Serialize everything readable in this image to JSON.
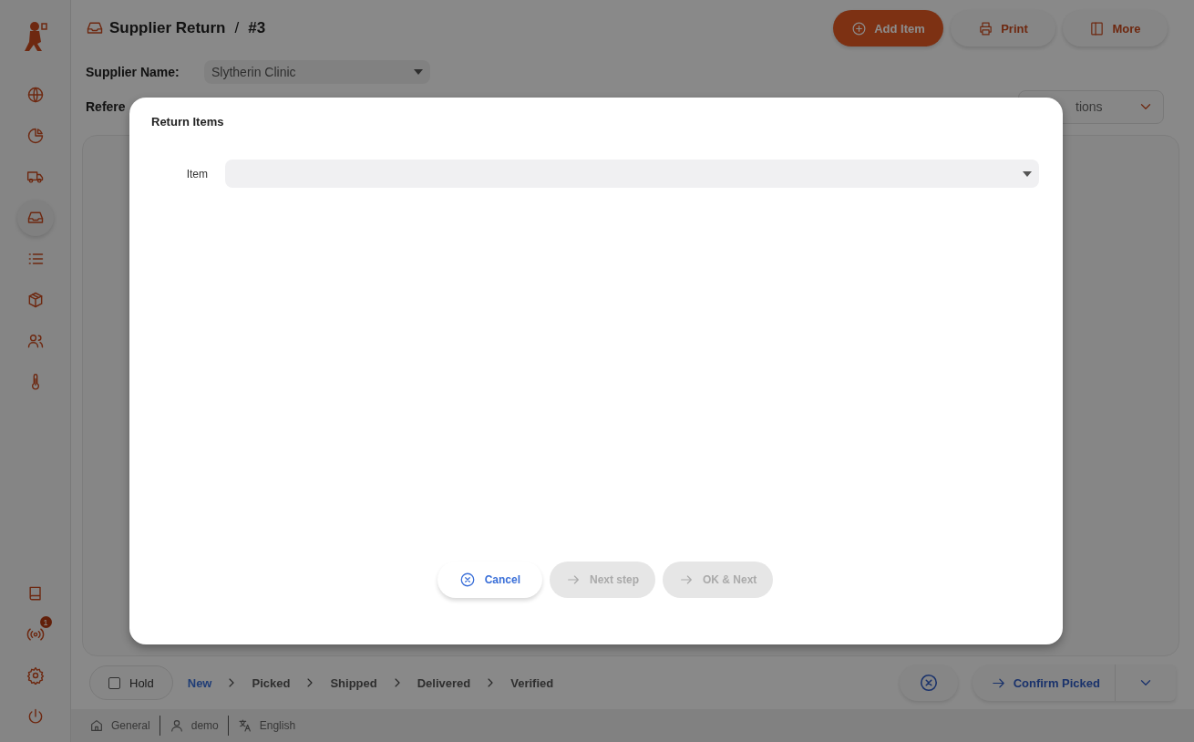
{
  "sidebar": {
    "items": [
      {
        "kind": "globe",
        "selected": false
      },
      {
        "kind": "chart",
        "selected": false
      },
      {
        "kind": "truck",
        "selected": false
      },
      {
        "kind": "inbox",
        "selected": true
      },
      {
        "kind": "list",
        "selected": false
      },
      {
        "kind": "box",
        "selected": false
      },
      {
        "kind": "users",
        "selected": false
      },
      {
        "kind": "thermometer",
        "selected": false
      }
    ],
    "bottom_items": [
      {
        "kind": "book"
      },
      {
        "kind": "broadcast",
        "badge": "1"
      },
      {
        "kind": "settings"
      },
      {
        "kind": "power"
      }
    ]
  },
  "header": {
    "title": "Supplier Return",
    "separator": "/",
    "number": "#3",
    "buttons": [
      {
        "label": "Add Item",
        "kind": "primary"
      },
      {
        "label": "Print",
        "kind": "secondary"
      },
      {
        "label": "More",
        "kind": "secondary"
      }
    ]
  },
  "form": {
    "supplier_label": "Supplier Name:",
    "supplier_value": "Slytherin Clinic",
    "reference_label": "Refere",
    "options_value": "tions"
  },
  "footer": {
    "hold": {
      "label": "Hold",
      "checked": false
    },
    "steps": [
      {
        "label": "New",
        "selected": true
      },
      {
        "label": "Picked",
        "selected": false
      },
      {
        "label": "Shipped",
        "selected": false
      },
      {
        "label": "Delivered",
        "selected": false
      },
      {
        "label": "Verified",
        "selected": false
      }
    ],
    "confirm_label": "Confirm Picked"
  },
  "status_bar": [
    {
      "kind": "home",
      "label": "General"
    },
    {
      "kind": "user",
      "label": "demo"
    },
    {
      "kind": "translate",
      "label": "English"
    }
  ],
  "modal": {
    "title": "Return Items",
    "field_label": "Item",
    "buttons": [
      {
        "label": "Cancel",
        "kind": "cancel",
        "disabled": false
      },
      {
        "label": "Next step",
        "kind": "advance",
        "disabled": true
      },
      {
        "label": "OK & Next",
        "kind": "advance",
        "disabled": true
      }
    ]
  }
}
